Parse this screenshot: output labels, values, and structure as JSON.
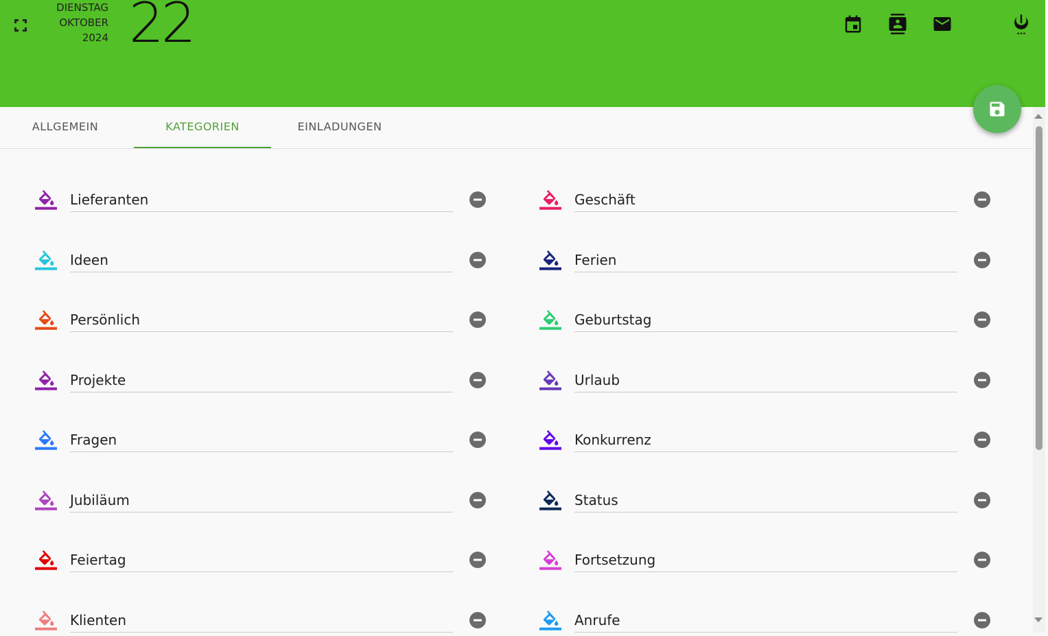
{
  "header": {
    "weekday": "DIENSTAG",
    "month": "OKTOBER",
    "year": "2024",
    "day": "22",
    "icons": [
      "fullscreen-icon",
      "calendar-icon",
      "contacts-icon",
      "mail-icon",
      "power-icon"
    ]
  },
  "tabs": [
    {
      "label": "ALLGEMEIN"
    },
    {
      "label": "KATEGORIEN",
      "active": true
    },
    {
      "label": "EINLADUNGEN"
    }
  ],
  "save_icon": "save-icon",
  "categories_left": [
    {
      "name": "Lieferanten",
      "color": "#8e24aa"
    },
    {
      "name": "Ideen",
      "color": "#26c6da"
    },
    {
      "name": "Persönlich",
      "color": "#e64a19"
    },
    {
      "name": "Projekte",
      "color": "#8e24aa"
    },
    {
      "name": "Fragen",
      "color": "#2979ff"
    },
    {
      "name": "Jubiläum",
      "color": "#ab47bc"
    },
    {
      "name": "Feiertag",
      "color": "#e00000"
    },
    {
      "name": "Klienten",
      "color": "#ef7f7f"
    }
  ],
  "categories_right": [
    {
      "name": "Geschäft",
      "color": "#e91e63"
    },
    {
      "name": "Ferien",
      "color": "#1a237e"
    },
    {
      "name": "Geburtstag",
      "color": "#2ecc71"
    },
    {
      "name": "Urlaub",
      "color": "#673ab7"
    },
    {
      "name": "Konkurrenz",
      "color": "#6200ea"
    },
    {
      "name": "Status",
      "color": "#0d2857"
    },
    {
      "name": "Fortsetzung",
      "color": "#d63fd6"
    },
    {
      "name": "Anrufe",
      "color": "#1e9bf0"
    }
  ],
  "colors": {
    "header_bg": "#52c026",
    "accent": "#52a03a",
    "fab_bg": "#5cb85c",
    "remove_icon": "#6b6b6b"
  }
}
